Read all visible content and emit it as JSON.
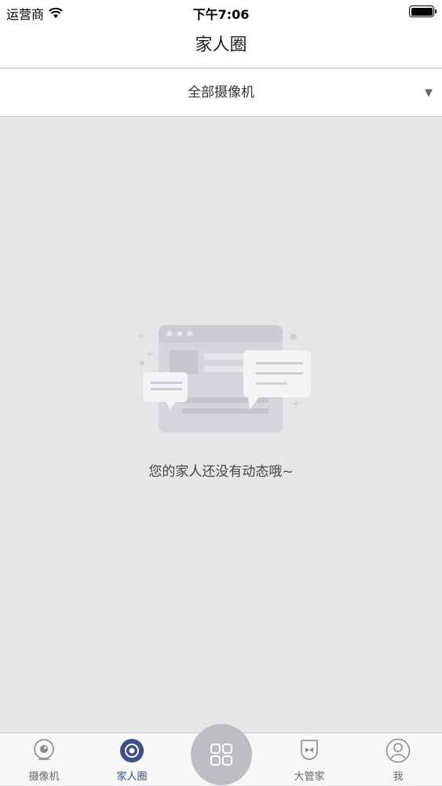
{
  "status_bar": {
    "carrier": "运营商",
    "time": "下午7:06",
    "wifi_icon": "wifi-icon",
    "battery_icon": "battery-icon"
  },
  "nav": {
    "title": "家人圈"
  },
  "filter": {
    "selected": "全部摄像机",
    "arrow": "▼"
  },
  "empty_state": {
    "icon": "chat-bubbles-illustration",
    "message": "您的家人还没有动态哦~"
  },
  "tab_bar": {
    "tabs": [
      {
        "label": "摄像机",
        "icon": "camera-icon",
        "active": false
      },
      {
        "label": "家人圈",
        "icon": "family-circle-icon",
        "active": true
      },
      {
        "label": "",
        "icon": "grid-icon",
        "active": false
      },
      {
        "label": "大管家",
        "icon": "butler-icon",
        "active": false
      },
      {
        "label": "我",
        "icon": "profile-icon",
        "active": false
      }
    ]
  },
  "colors": {
    "background": "#e6e6e9",
    "active_tab": "#3a4f86",
    "center_button": "#bdbdc2"
  }
}
